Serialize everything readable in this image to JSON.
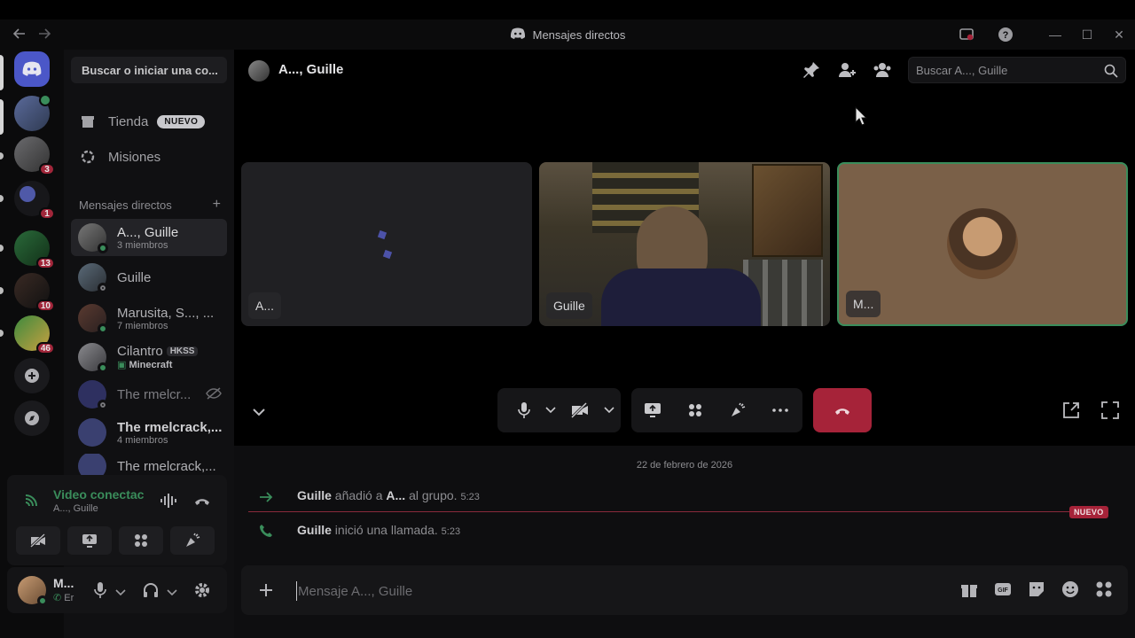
{
  "window": {
    "title": "Mensajes directos",
    "back_icon": "arrow-left-icon",
    "forward_icon": "arrow-right-icon",
    "minimize": "—",
    "maximize": "☐",
    "close": "✕"
  },
  "rail": {
    "badges": [
      "3",
      "1",
      "13",
      "10",
      "46"
    ]
  },
  "sidebar": {
    "search_placeholder": "Buscar o iniciar una co...",
    "shop_label": "Tienda",
    "shop_badge": "NUEVO",
    "quests_label": "Misiones",
    "dm_header": "Mensajes directos",
    "dm_add": "+",
    "dms": [
      {
        "name": "A..., Guille",
        "sub": "3 miembros"
      },
      {
        "name": "Guille",
        "sub": ""
      },
      {
        "name": "Marusita, S..., ...",
        "sub": "7 miembros"
      },
      {
        "name": "Cilantro",
        "tag": "HKSS",
        "sub": "Minecraft"
      },
      {
        "name": "The rmelcr...",
        "sub": ""
      },
      {
        "name": "The rmelcrack,...",
        "sub": "4 miembros"
      },
      {
        "name": "The rmelcrack,...",
        "sub": ""
      }
    ]
  },
  "voice": {
    "status": "Video conectac",
    "channel": "A..., Guille"
  },
  "user": {
    "name": "M...",
    "status": "Er"
  },
  "header": {
    "title": "A..., Guille",
    "search_placeholder": "Buscar A..., Guille"
  },
  "tiles": [
    {
      "label": "A..."
    },
    {
      "label": "Guille"
    },
    {
      "label": "M..."
    }
  ],
  "chat": {
    "date": "22 de febrero de 2026",
    "messages": [
      {
        "author": "Guille",
        "text_a": " añadió a ",
        "target": "A...",
        "text_b": " al grupo. ",
        "time": "5:23"
      },
      {
        "author": "Guille",
        "text_a": " inició una llamada. ",
        "time": "5:23"
      }
    ],
    "new_tag": "NUEVO",
    "composer_placeholder": "Mensaje A..., Guille"
  },
  "colors": {
    "accent": "#a62339",
    "online": "#3a8d5b",
    "brand": "#4b57c8"
  }
}
